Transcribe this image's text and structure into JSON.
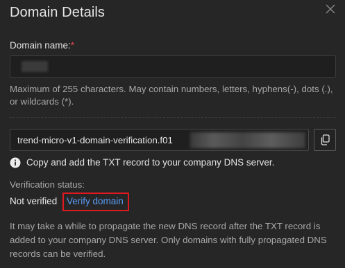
{
  "dialog": {
    "title": "Domain Details"
  },
  "domain_field": {
    "label": "Domain name:",
    "required_marker": "*",
    "hint": "Maximum of 255 characters. May contain numbers, letters, hyphens(-), dots (.), or wildcards (*)."
  },
  "txt_record": {
    "value": "trend-micro-v1-domain-verification.f01"
  },
  "info": {
    "text": "Copy and add the TXT record to your company DNS server."
  },
  "verification": {
    "label": "Verification status:",
    "status": "Not verified",
    "verify_link": "Verify domain",
    "note": "It may take a while to propagate the new DNS record after the TXT record is added to your company DNS server. Only domains with fully propagated DNS records can be verified."
  },
  "colors": {
    "background": "#262626",
    "link": "#5b9cf6",
    "required": "#e5484d",
    "highlight_box": "#e0181f"
  },
  "icons": {
    "close": "close-icon",
    "copy": "copy-icon",
    "info": "info-icon"
  }
}
